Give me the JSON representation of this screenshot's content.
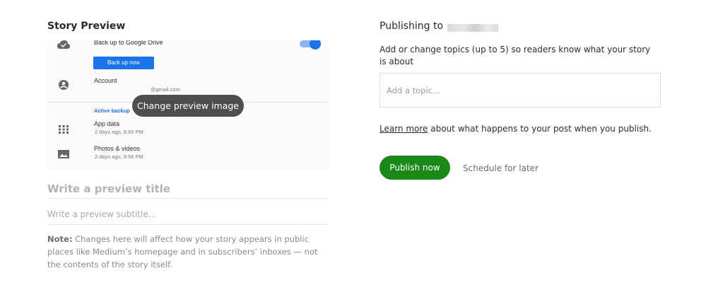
{
  "left": {
    "section_title": "Story Preview",
    "preview": {
      "backup_title": "Back up to Google Drive",
      "backup_button": "Back up now",
      "account_title": "Account",
      "account_sub": "@gmail.com",
      "active_label": "Active backup",
      "appdata_title": "App data",
      "appdata_sub": "2 days ago, 8:56 PM",
      "photos_title": "Photos & videos",
      "photos_sub": "2 days ago, 8:56 PM",
      "change_label": "Change preview image"
    },
    "title_placeholder": "Write a preview title",
    "subtitle_placeholder": "Write a preview subtitle...",
    "note_label": "Note:",
    "note_text": " Changes here will affect how your story appears in public places like Medium’s homepage and in subscribers’ inboxes — not the contents of the story itself."
  },
  "right": {
    "publishing_label": "Publishing to",
    "topics_help": "Add or change topics (up to 5) so readers know what your story is about",
    "topic_placeholder": "Add a topic...",
    "learn_link": "Learn more",
    "learn_text": " about what happens to your post when you publish.",
    "publish_button": "Publish now",
    "schedule_button": "Schedule for later"
  },
  "colors": {
    "publish_green": "#1a8917",
    "preview_bg": "#fafafa",
    "pill_bg": "#3a3a3a"
  },
  "icons": [
    "cloud-check-icon",
    "account-icon",
    "grid-icon",
    "image-icon"
  ]
}
